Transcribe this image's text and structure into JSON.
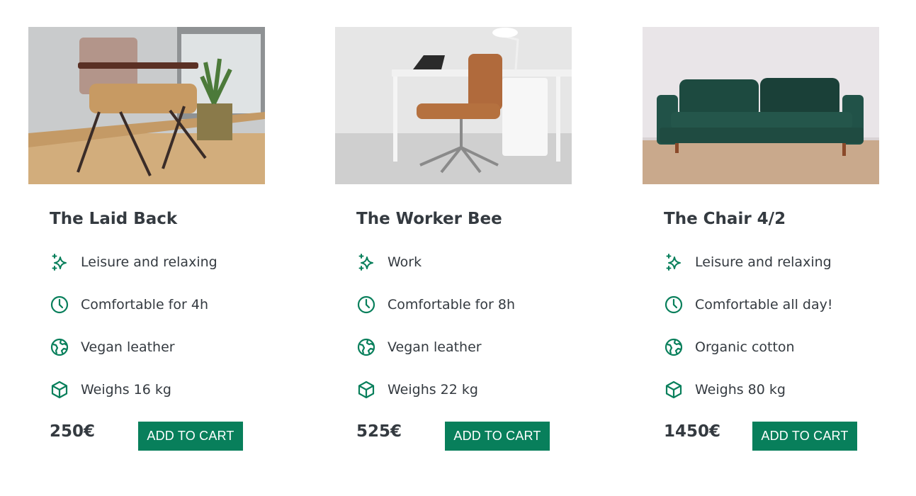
{
  "colors": {
    "accent": "#087f5b",
    "text": "#343a40",
    "background": "#ffffff"
  },
  "products": [
    {
      "title": "The Laid Back",
      "image_icon": "armchair-photo",
      "attributes": [
        {
          "icon": "sparkles-icon",
          "text": "Leisure and relaxing"
        },
        {
          "icon": "clock-icon",
          "text": "Comfortable for 4h"
        },
        {
          "icon": "globe-icon",
          "text": "Vegan leather"
        },
        {
          "icon": "cube-icon",
          "text": "Weighs 16 kg"
        }
      ],
      "price": "250€",
      "cta": "ADD TO CART"
    },
    {
      "title": "The Worker Bee",
      "image_icon": "office-chair-photo",
      "attributes": [
        {
          "icon": "sparkles-icon",
          "text": "Work"
        },
        {
          "icon": "clock-icon",
          "text": "Comfortable for 8h"
        },
        {
          "icon": "globe-icon",
          "text": "Vegan leather"
        },
        {
          "icon": "cube-icon",
          "text": "Weighs 22 kg"
        }
      ],
      "price": "525€",
      "cta": "ADD TO CART"
    },
    {
      "title": "The Chair 4/2",
      "image_icon": "sofa-photo",
      "attributes": [
        {
          "icon": "sparkles-icon",
          "text": "Leisure and relaxing"
        },
        {
          "icon": "clock-icon",
          "text": "Comfortable all day!"
        },
        {
          "icon": "globe-icon",
          "text": "Organic cotton"
        },
        {
          "icon": "cube-icon",
          "text": "Weighs 80 kg"
        }
      ],
      "price": "1450€",
      "cta": "ADD TO CART"
    }
  ]
}
